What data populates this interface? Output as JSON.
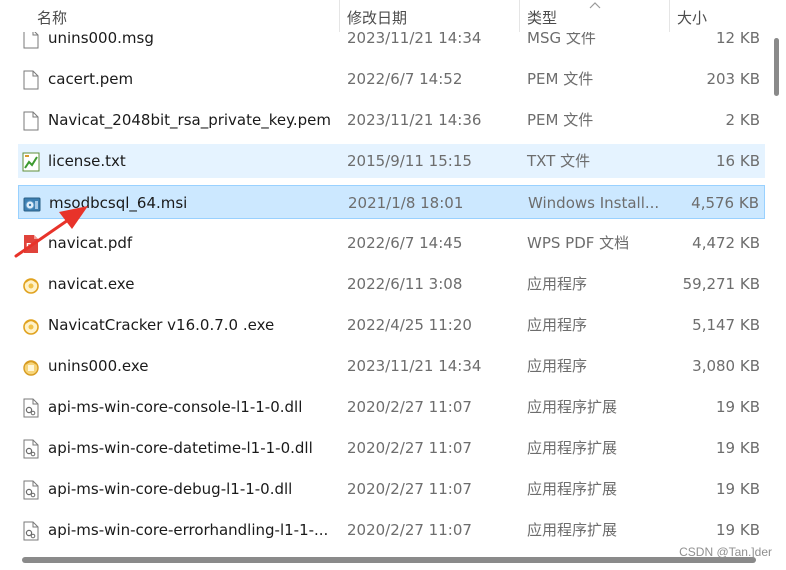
{
  "columns": {
    "name": "名称",
    "date": "修改日期",
    "type": "类型",
    "size": "大小"
  },
  "files": [
    {
      "name": "unins000.msg",
      "date": "2023/11/21 14:34",
      "type": "MSG 文件",
      "size": "12 KB",
      "icon": "blank-file-icon"
    },
    {
      "name": "cacert.pem",
      "date": "2022/6/7 14:52",
      "type": "PEM 文件",
      "size": "203 KB",
      "icon": "blank-file-icon"
    },
    {
      "name": "Navicat_2048bit_rsa_private_key.pem",
      "date": "2023/11/21 14:36",
      "type": "PEM 文件",
      "size": "2 KB",
      "icon": "blank-file-icon"
    },
    {
      "name": "license.txt",
      "date": "2015/9/11 15:15",
      "type": "TXT 文件",
      "size": "16 KB",
      "icon": "text-file-icon"
    },
    {
      "name": "msodbcsql_64.msi",
      "date": "2021/1/8 18:01",
      "type": "Windows Install...",
      "size": "4,576 KB",
      "icon": "installer-icon"
    },
    {
      "name": "navicat.pdf",
      "date": "2022/6/7 14:45",
      "type": "WPS PDF 文档",
      "size": "4,472 KB",
      "icon": "pdf-icon"
    },
    {
      "name": "navicat.exe",
      "date": "2022/6/11 3:08",
      "type": "应用程序",
      "size": "59,271 KB",
      "icon": "navicat-app-icon"
    },
    {
      "name": "NavicatCracker v16.0.7.0 .exe",
      "date": "2022/4/25 11:20",
      "type": "应用程序",
      "size": "5,147 KB",
      "icon": "navicat-app-icon"
    },
    {
      "name": "unins000.exe",
      "date": "2023/11/21 14:34",
      "type": "应用程序",
      "size": "3,080 KB",
      "icon": "uninstaller-icon"
    },
    {
      "name": "api-ms-win-core-console-l1-1-0.dll",
      "date": "2020/2/27 11:07",
      "type": "应用程序扩展",
      "size": "19 KB",
      "icon": "dll-file-icon"
    },
    {
      "name": "api-ms-win-core-datetime-l1-1-0.dll",
      "date": "2020/2/27 11:07",
      "type": "应用程序扩展",
      "size": "19 KB",
      "icon": "dll-file-icon"
    },
    {
      "name": "api-ms-win-core-debug-l1-1-0.dll",
      "date": "2020/2/27 11:07",
      "type": "应用程序扩展",
      "size": "19 KB",
      "icon": "dll-file-icon"
    },
    {
      "name": "api-ms-win-core-errorhandling-l1-1-...",
      "date": "2020/2/27 11:07",
      "type": "应用程序扩展",
      "size": "19 KB",
      "icon": "dll-file-icon"
    }
  ],
  "hover_index": 3,
  "selected_index": 4,
  "watermark": "CSDN @Tan.]der",
  "colors": {
    "hover": "#e5f3ff",
    "selected": "#cce8ff",
    "selected_border": "#99d1ff",
    "arrow": "#e8332a"
  }
}
